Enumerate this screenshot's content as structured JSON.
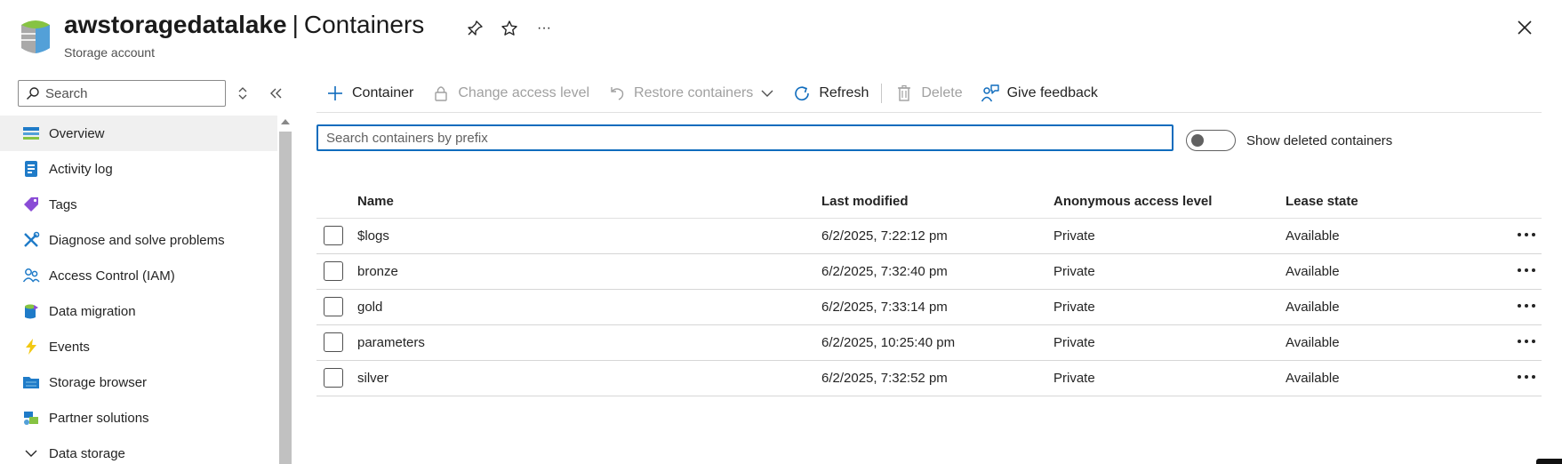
{
  "header": {
    "resource_name": "awstoragedatalake",
    "separator": "|",
    "page_title": "Containers",
    "subtitle": "Storage account",
    "more_label": "···"
  },
  "sidebar": {
    "search_placeholder": "Search",
    "items": [
      {
        "label": "Overview",
        "icon": "overview-icon",
        "active": true
      },
      {
        "label": "Activity log",
        "icon": "activity-log-icon"
      },
      {
        "label": "Tags",
        "icon": "tag-icon"
      },
      {
        "label": "Diagnose and solve problems",
        "icon": "wrench-icon"
      },
      {
        "label": "Access Control (IAM)",
        "icon": "people-icon"
      },
      {
        "label": "Data migration",
        "icon": "data-migration-icon"
      },
      {
        "label": "Events",
        "icon": "lightning-icon"
      },
      {
        "label": "Storage browser",
        "icon": "storage-browser-icon"
      },
      {
        "label": "Partner solutions",
        "icon": "partner-solutions-icon"
      },
      {
        "label": "Data storage",
        "icon": "chevron-down-icon"
      }
    ]
  },
  "toolbar": {
    "container": "Container",
    "change_access": "Change access level",
    "restore": "Restore containers",
    "refresh": "Refresh",
    "delete": "Delete",
    "feedback": "Give feedback"
  },
  "filter": {
    "placeholder": "Search containers by prefix",
    "toggle_label": "Show deleted containers",
    "toggle_on": false
  },
  "table": {
    "columns": [
      "Name",
      "Last modified",
      "Anonymous access level",
      "Lease state"
    ],
    "rows": [
      {
        "name": "$logs",
        "modified": "6/2/2025, 7:22:12 pm",
        "access": "Private",
        "lease": "Available"
      },
      {
        "name": "bronze",
        "modified": "6/2/2025, 7:32:40 pm",
        "access": "Private",
        "lease": "Available"
      },
      {
        "name": "gold",
        "modified": "6/2/2025, 7:33:14 pm",
        "access": "Private",
        "lease": "Available"
      },
      {
        "name": "parameters",
        "modified": "6/2/2025, 10:25:40 pm",
        "access": "Private",
        "lease": "Available"
      },
      {
        "name": "silver",
        "modified": "6/2/2025, 7:32:52 pm",
        "access": "Private",
        "lease": "Available"
      }
    ]
  },
  "colors": {
    "accent": "#0f6cbd",
    "text": "#242424",
    "disabled": "#a0a0a0"
  }
}
